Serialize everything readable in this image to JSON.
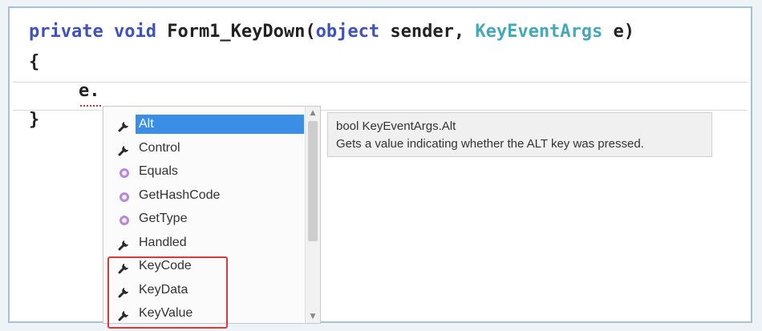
{
  "code": {
    "line1": {
      "kw1": "private",
      "kw2": "void",
      "method": "Form1_KeyDown(",
      "kw3": "object",
      "param1": "sender,",
      "type": "KeyEventArgs",
      "param2": "e)"
    },
    "open_brace": "{",
    "typed": "e.",
    "close_brace": "}"
  },
  "completion": {
    "items": [
      {
        "label": "Alt",
        "icon": "property-wrench-icon",
        "selected": true
      },
      {
        "label": "Control",
        "icon": "property-wrench-icon"
      },
      {
        "label": "Equals",
        "icon": "method-cube-icon"
      },
      {
        "label": "GetHashCode",
        "icon": "method-cube-icon"
      },
      {
        "label": "GetType",
        "icon": "method-cube-icon"
      },
      {
        "label": "Handled",
        "icon": "property-wrench-icon"
      },
      {
        "label": "KeyCode",
        "icon": "property-wrench-icon"
      },
      {
        "label": "KeyData",
        "icon": "property-wrench-icon"
      },
      {
        "label": "KeyValue",
        "icon": "property-wrench-icon"
      }
    ]
  },
  "tooltip": {
    "signature": "bool KeyEventArgs.Alt",
    "description": "Gets a value indicating whether the ALT key was pressed."
  },
  "colors": {
    "keyword": "#3f52b8",
    "type": "#45a8b8",
    "selection": "#3a8ee6",
    "highlight_border": "#d63a3a"
  }
}
